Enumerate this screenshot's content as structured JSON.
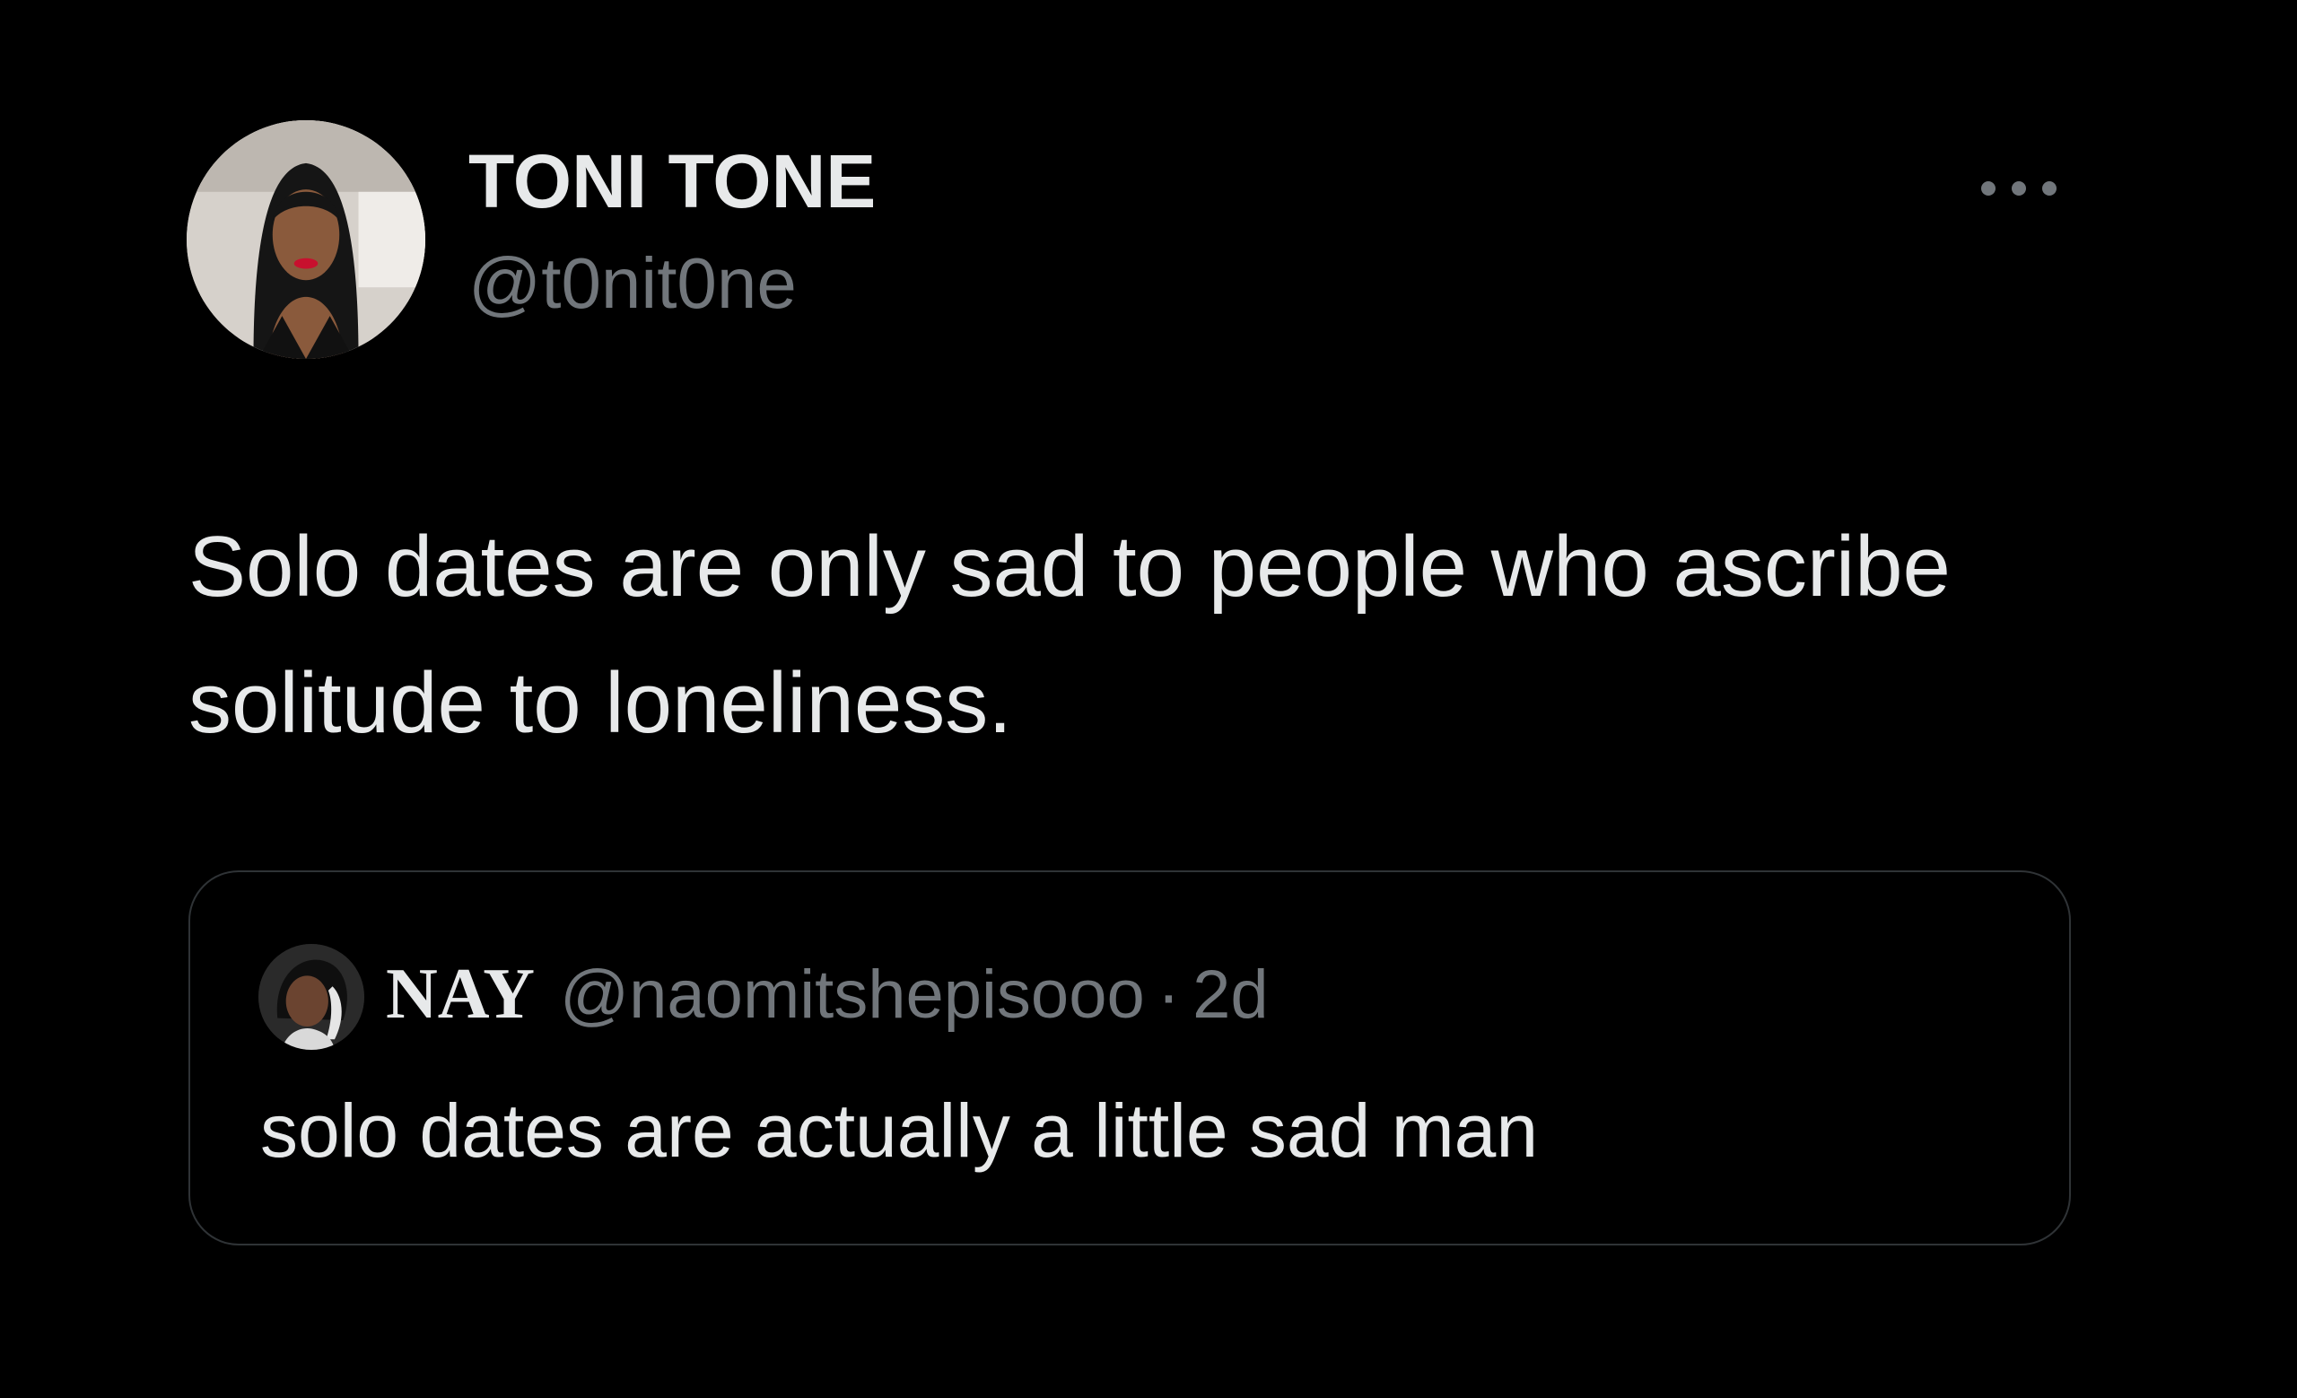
{
  "tweet": {
    "author": {
      "display_name": "TONI TONE",
      "handle": "@t0nit0ne",
      "avatar_icon": "profile-photo"
    },
    "more_icon": "more-horizontal-icon",
    "text": "Solo dates are only sad to people who ascribe solitude to loneliness.",
    "quote": {
      "display_name": "NAY",
      "handle": "@naomitshepisooo",
      "separator": "·",
      "time": "2d",
      "text": "solo dates are actually a little sad man",
      "avatar_icon": "profile-photo"
    }
  },
  "colors": {
    "background": "#000000",
    "primary_text": "#e7e9ea",
    "secondary_text": "#71767b",
    "border": "#2f3336"
  }
}
